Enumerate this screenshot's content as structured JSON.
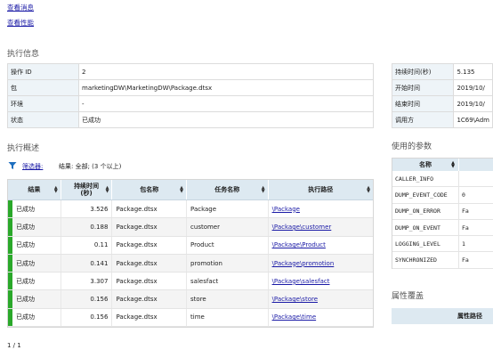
{
  "nav": {
    "view_messages": "查看消息",
    "view_performance": "查看性能"
  },
  "exec_info": {
    "title": "执行信息",
    "left": [
      {
        "key": "操作 ID",
        "value": "2"
      },
      {
        "key": "包",
        "value": "marketingDW\\MarketingDW\\Package.dtsx"
      },
      {
        "key": "环境",
        "value": "-"
      },
      {
        "key": "状态",
        "value": "已成功"
      }
    ],
    "right": [
      {
        "key": "持续时间(秒)",
        "value": "5.135"
      },
      {
        "key": "开始时间",
        "value": "2019/10/"
      },
      {
        "key": "结束时间",
        "value": "2019/10/"
      },
      {
        "key": "调用方",
        "value": "1C69\\Adm"
      }
    ]
  },
  "overview": {
    "title": "执行概述",
    "filter_link": "筛选器:",
    "filter_result": "结果: 全部; (3 个以上)",
    "columns": [
      "结果",
      "持续时间\n(秒)",
      "包名称",
      "任务名称",
      "执行路径"
    ],
    "rows": [
      {
        "result": "已成功",
        "duration": "3.526",
        "package": "Package.dtsx",
        "task": "Package",
        "path": "\\Package"
      },
      {
        "result": "已成功",
        "duration": "0.188",
        "package": "Package.dtsx",
        "task": "customer",
        "path": "\\Package\\customer"
      },
      {
        "result": "已成功",
        "duration": "0.11",
        "package": "Package.dtsx",
        "task": "Product",
        "path": "\\Package\\Product"
      },
      {
        "result": "已成功",
        "duration": "0.141",
        "package": "Package.dtsx",
        "task": "promotion",
        "path": "\\Package\\promotion"
      },
      {
        "result": "已成功",
        "duration": "3.307",
        "package": "Package.dtsx",
        "task": "salesfact",
        "path": "\\Package\\salesfact"
      },
      {
        "result": "已成功",
        "duration": "0.156",
        "package": "Package.dtsx",
        "task": "store",
        "path": "\\Package\\store"
      },
      {
        "result": "已成功",
        "duration": "0.156",
        "package": "Package.dtsx",
        "task": "time",
        "path": "\\Package\\time"
      }
    ],
    "pager": "1 / 1"
  },
  "params": {
    "title": "使用的参数",
    "col_name": "名称",
    "rows": [
      {
        "name": "CALLER_INFO",
        "value": ""
      },
      {
        "name": "DUMP_EVENT_CODE",
        "value": "0"
      },
      {
        "name": "DUMP_ON_ERROR",
        "value": "Fa"
      },
      {
        "name": "DUMP_ON_EVENT",
        "value": "Fa"
      },
      {
        "name": "LOGGING_LEVEL",
        "value": "1"
      },
      {
        "name": "SYNCHRONIZED",
        "value": "Fa"
      }
    ]
  },
  "overrides": {
    "title": "属性覆盖",
    "col_path": "属性路径"
  },
  "colors": {
    "success": "#2aa82a",
    "header_bg": "#dde9f1",
    "link": "#1a1aa6",
    "filter_icon": "#1e6fbf"
  }
}
